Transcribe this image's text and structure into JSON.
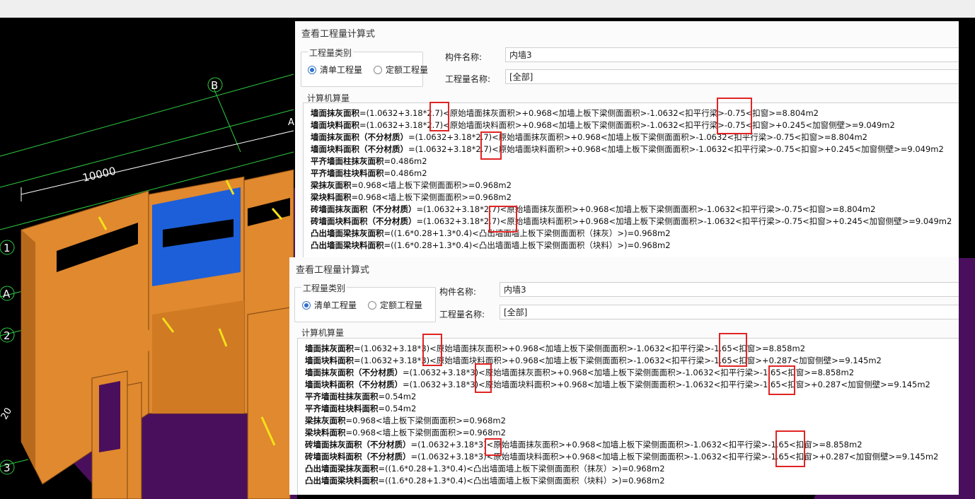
{
  "cad": {
    "grid_labels": [
      "B",
      "1",
      "A",
      "2",
      "3"
    ],
    "dimension": "10000",
    "partial_marks": [
      "A",
      "20"
    ]
  },
  "dialogs": [
    {
      "title": "查看工程量计算式",
      "group_label": "工程量类别",
      "radio_qingdan": "清单工程量",
      "radio_dinge": "定额工程量",
      "component_label": "构件名称:",
      "component_value": "内墙3",
      "quantity_label": "工程量名称:",
      "quantity_value": "[全部]",
      "calc_label": "计算机算量",
      "lines": [
        {
          "name": "墙面抹灰面积",
          "expr": "=(1.0632+3.18*2.7)<原始墙面抹灰面积>+0.968<加墙上板下梁侧面面积>-1.0632<扣平行梁>-0.75<扣窗>=8.804m2"
        },
        {
          "name": "墙面块料面积",
          "expr": "=(1.0632+3.18*2.7)<原始墙面块料面积>+0.968<加墙上板下梁侧面面积>-1.0632<扣平行梁>-0.75<扣窗>+0.245<加窗侧壁>=9.049m2"
        },
        {
          "name": "墙面抹灰面积（不分材质）",
          "expr": "=(1.0632+3.18*2.7)<原始墙面抹灰面积>+0.968<加墙上板下梁侧面面积>-1.0632<扣平行梁>-0.75<扣窗>=8.804m2"
        },
        {
          "name": "墙面块料面积（不分材质）",
          "expr": "=(1.0632+3.18*2.7)<原始墙面块料面积>+0.968<加墙上板下梁侧面面积>-1.0632<扣平行梁>-0.75<扣窗>+0.245<加窗侧壁>=9.049m2"
        },
        {
          "name": "平齐墙面柱抹灰面积",
          "expr": "=0.486m2"
        },
        {
          "name": "平齐墙面柱块料面积",
          "expr": "=0.486m2"
        },
        {
          "name": "梁抹灰面积",
          "expr": "=0.968<墙上板下梁侧面面积>=0.968m2"
        },
        {
          "name": "梁块料面积",
          "expr": "=0.968<墙上板下梁侧面面积>=0.968m2"
        },
        {
          "name": "砖墙面抹灰面积（不分材质）",
          "expr": "=(1.0632+3.18*2.7)<原始墙面抹灰面积>+0.968<加墙上板下梁侧面面积>-1.0632<扣平行梁>-0.75<扣窗>=8.804m2"
        },
        {
          "name": "砖墙面块料面积（不分材质）",
          "expr": "=(1.0632+3.18*2.7)<原始墙面块料面积>+0.968<加墙上板下梁侧面面积>-1.0632<扣平行梁>-0.75<扣窗>+0.245<加窗侧壁>=9.049m2"
        },
        {
          "name": "凸出墙面梁抹灰面积",
          "expr": "=((1.6*0.28+1.3*0.4)<凸出墙面墙上板下梁侧面面积（抹灰）>)=0.968m2"
        },
        {
          "name": "凸出墙面梁块料面积",
          "expr": "=((1.6*0.28+1.3*0.4)<凸出墙面墙上板下梁侧面面积（块料）>)=0.968m2"
        }
      ]
    },
    {
      "title": "查看工程量计算式",
      "group_label": "工程量类别",
      "radio_qingdan": "清单工程量",
      "radio_dinge": "定额工程量",
      "component_label": "构件名称:",
      "component_value": "内墙3",
      "quantity_label": "工程量名称:",
      "quantity_value": "[全部]",
      "calc_label": "计算机算量",
      "lines": [
        {
          "name": "墙面抹灰面积",
          "expr": "=(1.0632+3.18*3)<原始墙面抹灰面积>+0.968<加墙上板下梁侧面面积>-1.0632<扣平行梁>-1.65<扣窗>=8.858m2"
        },
        {
          "name": "墙面块料面积",
          "expr": "=(1.0632+3.18*3)<原始墙面块料面积>+0.968<加墙上板下梁侧面面积>-1.0632<扣平行梁>-1.65<扣窗>+0.287<加窗侧壁>=9.145m2"
        },
        {
          "name": "墙面抹灰面积（不分材质）",
          "expr": "=(1.0632+3.18*3)<原始墙面抹灰面积>+0.968<加墙上板下梁侧面面积>-1.0632<扣平行梁>-1.65<扣窗>=8.858m2"
        },
        {
          "name": "墙面块料面积（不分材质）",
          "expr": "=(1.0632+3.18*3)<原始墙面块料面积>+0.968<加墙上板下梁侧面面积>-1.0632<扣平行梁>-1.65<扣窗>+0.287<加窗侧壁>=9.145m2"
        },
        {
          "name": "平齐墙面柱抹灰面积",
          "expr": "=0.54m2"
        },
        {
          "name": "平齐墙面柱块料面积",
          "expr": "=0.54m2"
        },
        {
          "name": "梁抹灰面积",
          "expr": "=0.968<墙上板下梁侧面面积>=0.968m2"
        },
        {
          "name": "梁块料面积",
          "expr": "=0.968<墙上板下梁侧面面积>=0.968m2"
        },
        {
          "name": "砖墙面抹灰面积（不分材质）",
          "expr": "=(1.0632+3.18*3)<原始墙面抹灰面积>+0.968<加墙上板下梁侧面面积>-1.0632<扣平行梁>-1.65<扣窗>=8.858m2"
        },
        {
          "name": "砖墙面块料面积（不分材质）",
          "expr": "=(1.0632+3.18*3)<原始墙面块料面积>+0.968<加墙上板下梁侧面面积>-1.0632<扣平行梁>-1.65<扣窗>+0.287<加窗侧壁>=9.145m2"
        },
        {
          "name": "凸出墙面梁抹灰面积",
          "expr": "=((1.6*0.28+1.3*0.4)<凸出墙面墙上板下梁侧面面积（抹灰）>)=0.968m2"
        },
        {
          "name": "凸出墙面梁块料面积",
          "expr": "=((1.6*0.28+1.3*0.4)<凸出墙面墙上板下梁侧面面积（块料）>)=0.968m2"
        }
      ]
    }
  ],
  "colors": {
    "highlight_red": "#e02424",
    "wall_orange": "#e0892e",
    "floor_purple": "#4a0f5c",
    "blue_fill": "#1d5fd8",
    "grid_green": "#2ecc40"
  }
}
